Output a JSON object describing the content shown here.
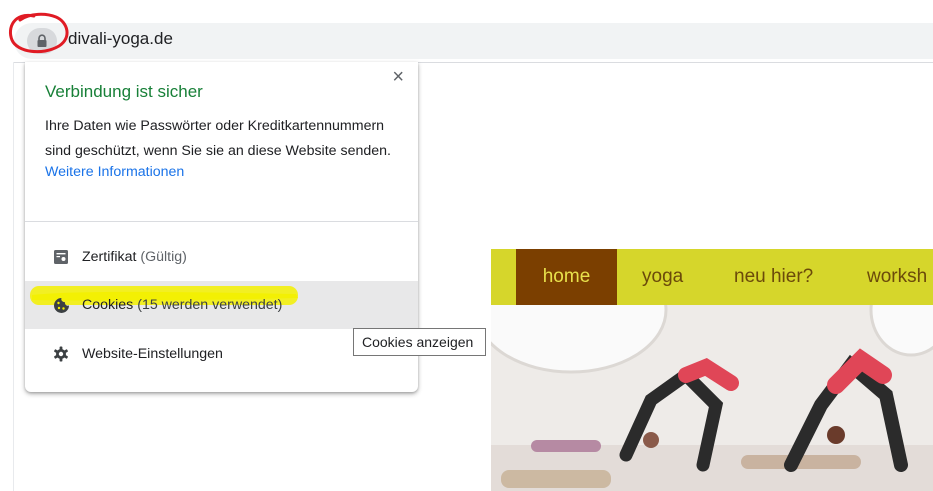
{
  "browser": {
    "url": "divali-yoga.de"
  },
  "popup": {
    "title": "Verbindung ist sicher",
    "close_label": "×",
    "description": "Ihre Daten wie Passwörter oder Kreditkartennummern sind geschützt, wenn Sie sie an diese Website senden.",
    "more_info_link": "Weitere Informationen",
    "items": [
      {
        "label": "Zertifikat",
        "sub": "(Gültig)",
        "icon": "certificate-icon"
      },
      {
        "label": "Cookies",
        "sub": "(15 werden verwendet)",
        "icon": "cookie-icon"
      },
      {
        "label": "Website-Einstellungen",
        "sub": "",
        "icon": "gear-icon"
      }
    ]
  },
  "tooltip": "Cookies anzeigen",
  "site": {
    "nav": [
      "home",
      "yoga",
      "neu hier?",
      "worksh"
    ],
    "nav_active": "home"
  },
  "colors": {
    "secure_green": "#188038",
    "link_blue": "#1a73e8",
    "nav_yellow": "#d6d62b",
    "nav_active_brown": "#7b3f00",
    "annotation_red": "#e01b24",
    "annotation_highlight": "#f3f000"
  }
}
